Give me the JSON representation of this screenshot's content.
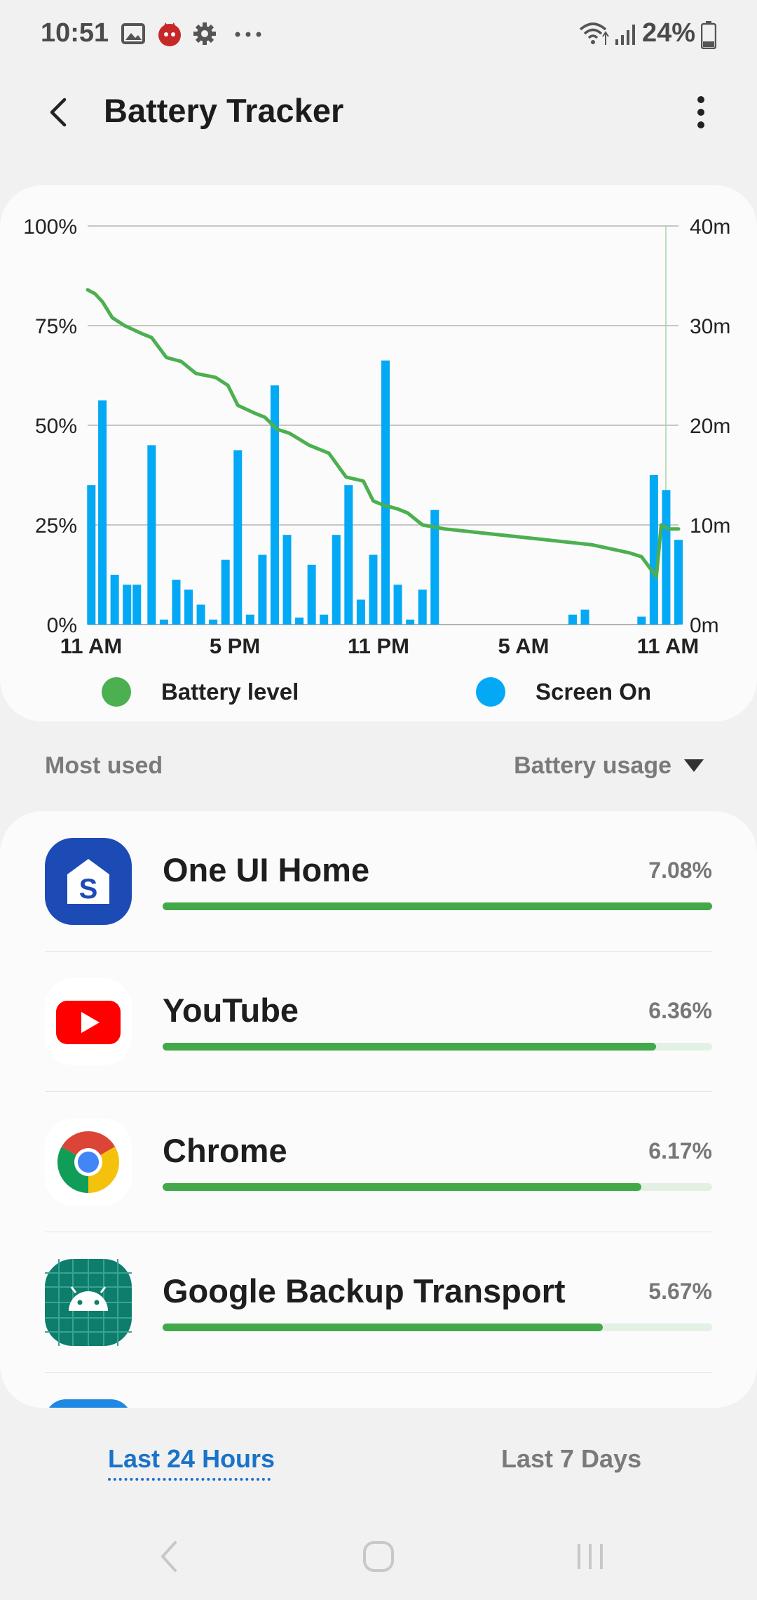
{
  "status_bar": {
    "time": "10:51",
    "battery_percent": "24%",
    "icons": [
      "gallery-icon",
      "app-notification-icon",
      "settings-gear-icon",
      "more-dots-icon",
      "wifi-icon",
      "signal-icon",
      "battery-icon"
    ]
  },
  "header": {
    "title": "Battery Tracker",
    "back_icon": "back-arrow-icon",
    "menu_icon": "more-vert-icon"
  },
  "chart_data": {
    "type": "bar",
    "x_tick_labels": [
      "11 AM",
      "5 PM",
      "11 PM",
      "5 AM",
      "11 AM"
    ],
    "y_left_ticks": [
      "0%",
      "25%",
      "50%",
      "75%",
      "100%"
    ],
    "y_right_ticks": [
      "0m",
      "10m",
      "20m",
      "30m",
      "40m"
    ],
    "y_left_range": [
      0,
      100
    ],
    "y_right_range": [
      0,
      40
    ],
    "x_range_hours": [
      0,
      24
    ],
    "grid": true,
    "legend": "bottom",
    "series": [
      {
        "name": "Battery level",
        "type": "line",
        "color": "#4caf50",
        "axis": "left",
        "points": [
          [
            0,
            84
          ],
          [
            0.3,
            83
          ],
          [
            0.6,
            81
          ],
          [
            1.0,
            77
          ],
          [
            1.5,
            75
          ],
          [
            2.2,
            73
          ],
          [
            2.6,
            72
          ],
          [
            3.2,
            67
          ],
          [
            3.8,
            66
          ],
          [
            4.4,
            63
          ],
          [
            5.2,
            62
          ],
          [
            5.7,
            60
          ],
          [
            6.1,
            55
          ],
          [
            6.8,
            53
          ],
          [
            7.2,
            52
          ],
          [
            7.7,
            49
          ],
          [
            8.2,
            48
          ],
          [
            9.0,
            45
          ],
          [
            9.8,
            43
          ],
          [
            10.5,
            37
          ],
          [
            11.2,
            36
          ],
          [
            11.6,
            31
          ],
          [
            12.0,
            30
          ],
          [
            12.6,
            29
          ],
          [
            13.0,
            28
          ],
          [
            13.6,
            25
          ],
          [
            14.5,
            24
          ],
          [
            16.0,
            23
          ],
          [
            17.5,
            22
          ],
          [
            19.0,
            21
          ],
          [
            20.5,
            20
          ],
          [
            22.0,
            18
          ],
          [
            22.5,
            17
          ],
          [
            23.1,
            12
          ],
          [
            23.3,
            25
          ],
          [
            23.6,
            24
          ],
          [
            24.0,
            24
          ]
        ]
      },
      {
        "name": "Screen On",
        "type": "bar",
        "color": "#03a9f4",
        "axis": "right",
        "unit": "minutes",
        "bars": [
          [
            0.15,
            14
          ],
          [
            0.6,
            22.5
          ],
          [
            1.1,
            5
          ],
          [
            1.6,
            4
          ],
          [
            2.0,
            4
          ],
          [
            2.6,
            18
          ],
          [
            3.1,
            0.5
          ],
          [
            3.6,
            4.5
          ],
          [
            4.1,
            3.5
          ],
          [
            4.6,
            2
          ],
          [
            5.1,
            0.5
          ],
          [
            5.6,
            6.5
          ],
          [
            6.1,
            17.5
          ],
          [
            6.6,
            1
          ],
          [
            7.1,
            7
          ],
          [
            7.6,
            24
          ],
          [
            8.1,
            9
          ],
          [
            8.6,
            0.7
          ],
          [
            9.1,
            6
          ],
          [
            9.6,
            1
          ],
          [
            10.1,
            9
          ],
          [
            10.6,
            14
          ],
          [
            11.1,
            2.5
          ],
          [
            11.6,
            7
          ],
          [
            12.1,
            26.5
          ],
          [
            12.6,
            4
          ],
          [
            13.1,
            0.5
          ],
          [
            13.6,
            3.5
          ],
          [
            14.1,
            11.5
          ],
          [
            19.7,
            1
          ],
          [
            20.2,
            1.5
          ],
          [
            22.5,
            0.8
          ],
          [
            23.0,
            15
          ],
          [
            23.5,
            13.5
          ],
          [
            24.0,
            8.5
          ]
        ]
      }
    ]
  },
  "legend": {
    "battery_label": "Battery level",
    "screen_label": "Screen On"
  },
  "section": {
    "left_label": "Most used",
    "sort_label": "Battery usage"
  },
  "apps": [
    {
      "name": "One UI Home",
      "percent": "7.08%",
      "value": 7.08,
      "fill_fraction": 1.0,
      "icon": "one-ui-home-icon"
    },
    {
      "name": "YouTube",
      "percent": "6.36%",
      "value": 6.36,
      "fill_fraction": 0.898,
      "icon": "youtube-icon"
    },
    {
      "name": "Chrome",
      "percent": "6.17%",
      "value": 6.17,
      "fill_fraction": 0.871,
      "icon": "chrome-icon"
    },
    {
      "name": "Google Backup Transport",
      "percent": "5.67%",
      "value": 5.67,
      "fill_fraction": 0.801,
      "icon": "android-icon"
    }
  ],
  "tabs": {
    "active": "Last 24 Hours",
    "inactive": "Last 7 Days"
  },
  "colors": {
    "accent_blue": "#1a73c8",
    "battery_green": "#4caf50",
    "screen_blue": "#03a9f4"
  }
}
